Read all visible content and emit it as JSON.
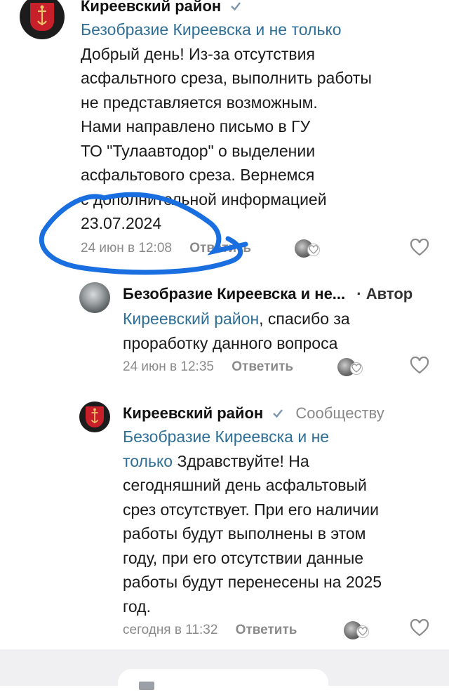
{
  "comments": [
    {
      "author": "Киреевский район",
      "author_suffix": "",
      "reply_to": "Безобразие Киреевска и не только",
      "lines": [
        "Добрый день! Из-за отсутствия",
        "асфальтного среза, выполнить работы",
        "не представляется возможным.",
        "Нами направлено письмо в ГУ",
        "ТО \"Тулаавтодор\" о выделении",
        "асфальтового среза. Вернемся",
        "с дополнительной информацией",
        "23.07.2024"
      ],
      "time": "24 июн в 12:08",
      "reply_label": "Ответить"
    },
    {
      "author": "Безобразие Киреевска и не...",
      "author_suffix": "· Автор",
      "reply_to": "Киреевский район",
      "text_after_link": ", спасибо за",
      "lines": [
        "проработку данного вопроса"
      ],
      "time": "24 июн в 12:35",
      "reply_label": "Ответить"
    },
    {
      "author": "Киреевский район",
      "author_suffix": "Сообществу",
      "reply_to_line1": "Безобразие Киреевска и не",
      "reply_to_line2": "только",
      "text_after_link": " Здравствуйте! На",
      "lines": [
        "сегодняшний день асфальтовый",
        "срез отсутствует. При его наличии",
        "работы будут выполнены в этом",
        "году, при его отсутствии данные",
        "работы будут перенесены на 2025",
        "год."
      ],
      "time": "сегодня в 11:32",
      "reply_label": "Ответить"
    }
  ],
  "icons": {
    "verified": "verified-check-icon",
    "like": "heart-outline-icon",
    "reactions": "reactions-avatars-icon"
  },
  "colors": {
    "link": "#2f6f97",
    "annotation": "#1a6fe0",
    "crest_red": "#c8202a"
  }
}
